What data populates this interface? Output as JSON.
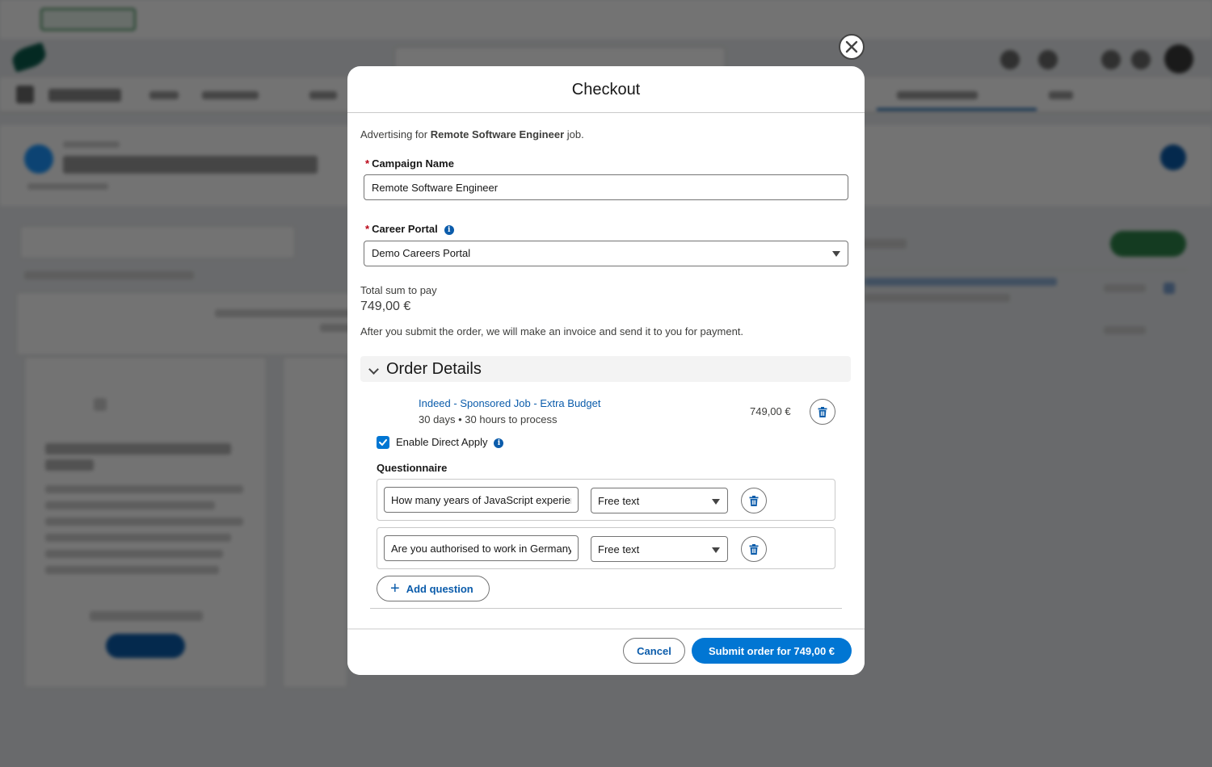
{
  "modal": {
    "title": "Checkout",
    "intro": {
      "prefix": "Advertising for ",
      "job_title": "Remote Software Engineer",
      "suffix": " job."
    },
    "campaign_name": {
      "required_mark": "*",
      "label": "Campaign Name",
      "value": "Remote Software Engineer"
    },
    "career_portal": {
      "required_mark": "*",
      "label": "Career Portal",
      "value": "Demo Careers Portal"
    },
    "total": {
      "label": "Total sum to pay",
      "value": "749,00 €"
    },
    "invoice_note": "After you submit the order, we will make an invoice and send it to you for payment.",
    "order_details": {
      "title": "Order Details",
      "product": {
        "name": "Indeed - Sponsored Job - Extra Budget",
        "meta": "30 days • 30 hours to process",
        "price": "749,00 €"
      },
      "direct_apply": {
        "label": "Enable Direct Apply",
        "checked": true
      },
      "questionnaire_label": "Questionnaire",
      "questions": [
        {
          "text": "How many years of JavaScript experience do you have?",
          "type": "Free text"
        },
        {
          "text": "Are you authorised to work in Germany?",
          "type": "Free text"
        }
      ],
      "add_question_label": "Add question"
    },
    "footer": {
      "cancel_label": "Cancel",
      "submit_label": "Submit order for 749,00 €"
    }
  },
  "colors": {
    "brand_blue": "#0176d3",
    "link_blue": "#0b5cab",
    "required_red": "#ba0517"
  }
}
